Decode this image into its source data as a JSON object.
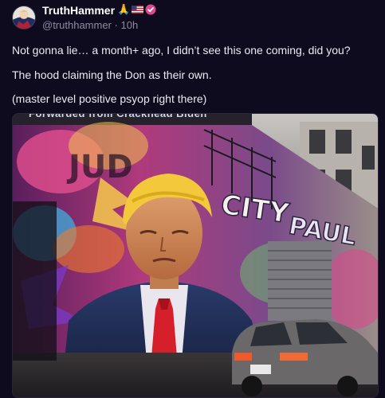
{
  "author": {
    "display_name": "TruthHammer",
    "badges": [
      "praying-hands-icon",
      "us-flag-icon",
      "verified-badge-icon"
    ],
    "handle": "@truthhammer",
    "separator": "·",
    "timestamp": "10h"
  },
  "post": {
    "lines": [
      "Not gonna lie… a month+ ago, I didn’t see this one coming, did you?",
      "The hood claiming the Don as their own.",
      "(master level positive psyop right there)"
    ]
  },
  "media": {
    "caption": "Forwarded from Crackhead Biden",
    "graffiti_text": [
      "CITY",
      "PAUL",
      "JUD"
    ],
    "accent_colors": [
      "#e0468a",
      "#f2c14e",
      "#3bb7e6",
      "#7a3ac9"
    ]
  }
}
